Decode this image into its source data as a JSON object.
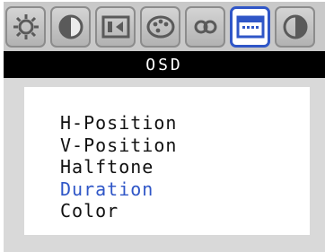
{
  "tabs": [
    {
      "icon": "brightness-icon",
      "active": false
    },
    {
      "icon": "contrast-icon",
      "active": false
    },
    {
      "icon": "position-icon",
      "active": false
    },
    {
      "icon": "color-palette-icon",
      "active": false
    },
    {
      "icon": "image-settings-icon",
      "active": false
    },
    {
      "icon": "osd-icon",
      "active": true
    },
    {
      "icon": "misc-icon",
      "active": false
    }
  ],
  "title": "OSD",
  "menu": {
    "items": [
      {
        "label": "H-Position",
        "selected": false
      },
      {
        "label": "V-Position",
        "selected": false
      },
      {
        "label": "Halftone",
        "selected": false
      },
      {
        "label": "Duration",
        "selected": true
      },
      {
        "label": "Color",
        "selected": false
      }
    ]
  },
  "colors": {
    "accent": "#2f56c7",
    "title_bg": "#000000",
    "panel_bg": "#d9d9d9",
    "tab_bg": "#c9c9c9"
  }
}
